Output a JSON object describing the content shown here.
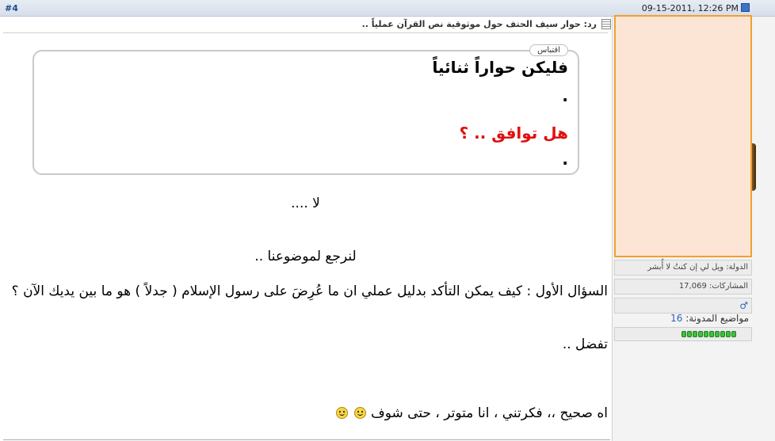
{
  "header": {
    "post_number": "#4",
    "date_time": "09-15-2011, 12:26 PM"
  },
  "post": {
    "title": "رد: حوار سيف الحتف حول موثوقية نص القرآن عملياً ..",
    "quote": {
      "label": "اقتباس",
      "line1": "فليكن حواراً ثنائياً",
      "dot1": ".",
      "line2": "هل توافق .. ؟",
      "dot2": "."
    },
    "body": {
      "line1": "لا ....",
      "line2": "لنرجع لموضوعنا ..",
      "line3": "السؤال الأول : كيف يمكن التأكد بدليل عملي ان ما عُرِضَ على رسول الإسلام ( جدلاً ) هو ما بين يديك الآن ؟",
      "line4": "تفضل ..",
      "line5": "اه صحيح ،، فكرتني ، انا متوتر ، حتى شوف"
    }
  },
  "user": {
    "country": "الدولة: ويل لي إن كنتُ لا أُبشر",
    "posts": "المشاركات: 17,069",
    "gender_icon": "male-icon",
    "blog_topics_label": "مواضيع المدونة:",
    "blog_topics_count": "16",
    "reputation_pips": 10
  },
  "colors": {
    "accent": "#1d4b8f",
    "quote_red": "#e01010",
    "avatar_bg": "#fde5d5",
    "avatar_border": "#f0a030",
    "reputation": "#3fbf3f"
  }
}
